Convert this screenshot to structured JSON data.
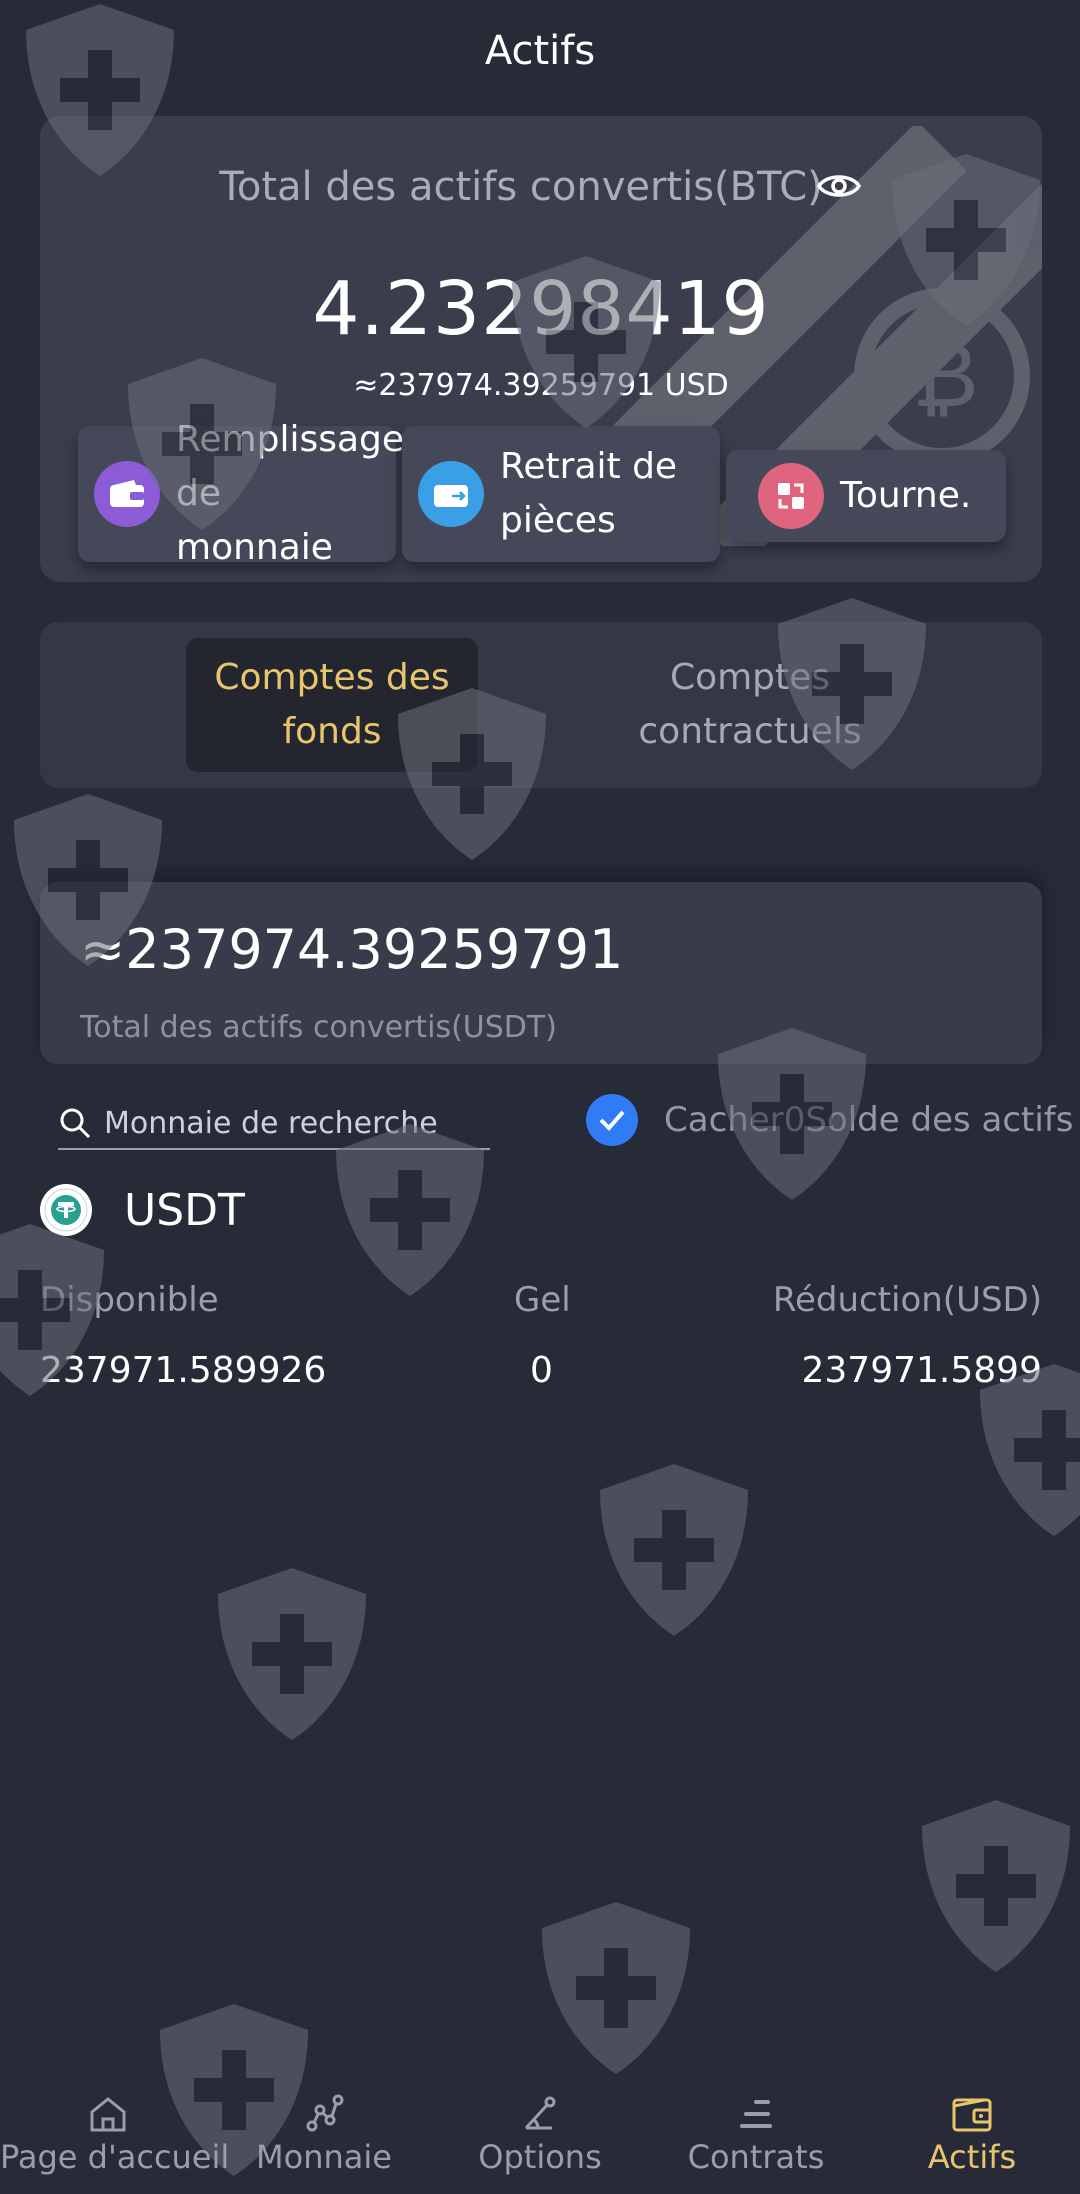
{
  "header": {
    "title": "Actifs"
  },
  "summary": {
    "label": "Total des actifs convertis(BTC)",
    "btc_total": "4.23298419",
    "usd_equiv": "≈237974.39259791 USD"
  },
  "actions": [
    {
      "label": "Remplissage de monnaie",
      "icon": "wallet-in-icon",
      "color": "#8b5cd6"
    },
    {
      "label": "Retrait de pièces",
      "icon": "wallet-out-icon",
      "color": "#3aa0e6"
    },
    {
      "label": "Tourne.",
      "icon": "transfer-icon",
      "color": "#e0647e"
    }
  ],
  "tabs": [
    {
      "label": "Comptes des fonds",
      "active": true
    },
    {
      "label": "Comptes contractuels",
      "active": false
    }
  ],
  "usdt_total": {
    "value": "≈237974.39259791",
    "label": "Total des actifs convertis(USDT)"
  },
  "search": {
    "placeholder": "Monnaie de recherche"
  },
  "hide_zero": {
    "label": "Cacher0Solde des actifs",
    "checked": true
  },
  "coin": {
    "name": "USDT",
    "columns": [
      "Disponible",
      "Gel",
      "Réduction(USD)"
    ],
    "values": [
      "237971.589926",
      "0",
      "237971.5899"
    ]
  },
  "tabbar": [
    {
      "label": "Page d'accueil",
      "icon": "home-icon",
      "active": false
    },
    {
      "label": "Monnaie",
      "icon": "market-icon",
      "active": false
    },
    {
      "label": "Options",
      "icon": "options-icon",
      "active": false
    },
    {
      "label": "Contrats",
      "icon": "contracts-icon",
      "active": false
    },
    {
      "label": "Actifs",
      "icon": "wallet-icon",
      "active": true
    }
  ],
  "colors": {
    "background": "#272a37",
    "accent": "#e9c56c",
    "check": "#2f7cf6"
  }
}
